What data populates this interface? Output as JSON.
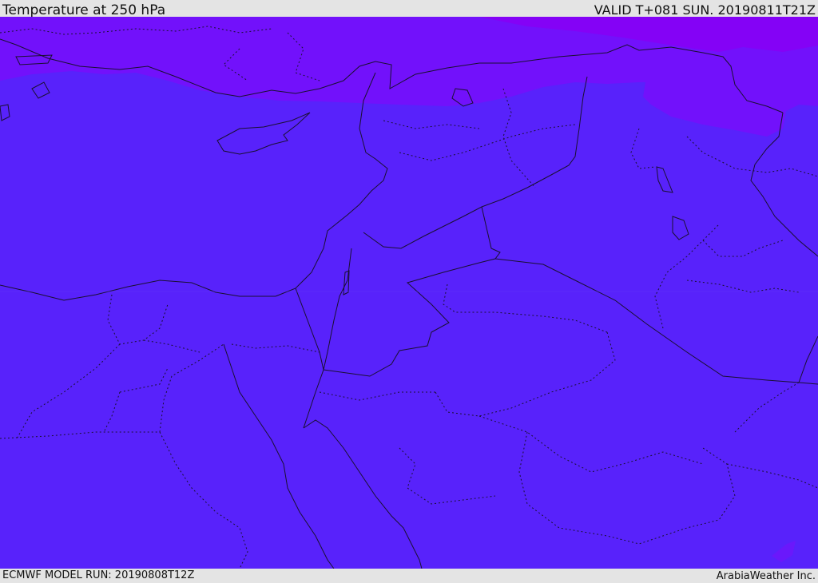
{
  "header": {
    "title": "Temperature at 250 hPa",
    "valid": "VALID T+081 SUN. 20190811T21Z"
  },
  "footer": {
    "model_run": "ECMWF MODEL RUN: 20190808T12Z",
    "credit": "ArabiaWeather Inc."
  },
  "colors": {
    "base_field": "#5822fb",
    "cold_band": "#7211fb",
    "coldest_band": "#8402f6",
    "border_line": "#1a1030",
    "frame": "#e4e4e4"
  },
  "map": {
    "field": "Temperature",
    "level": "250 hPa",
    "model": "ECMWF",
    "run": "20190808T12Z",
    "valid": "20190811T21Z",
    "legend": null
  }
}
